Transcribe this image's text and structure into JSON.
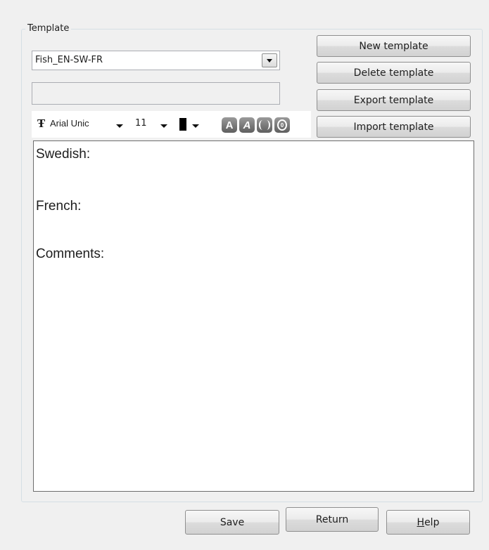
{
  "group": {
    "title": "Template"
  },
  "template_select": {
    "value": "Fish_EN-SW-FR",
    "icon": "chevron-down-icon"
  },
  "name_field": {
    "value": ""
  },
  "buttons": {
    "new": "New template",
    "delete": "Delete template",
    "export": "Export template",
    "import": "Import template"
  },
  "toolbar": {
    "font": "Arial Unic",
    "size": "11",
    "text_color": "#000000",
    "bold_label": "A",
    "italic_label": "A",
    "circle_label": "0"
  },
  "editor": {
    "lines": [
      "Swedish:",
      "French:",
      "Comments:"
    ]
  },
  "footer": {
    "save": "Save",
    "return": "Return",
    "help_underline": "H",
    "help_rest": "elp"
  }
}
